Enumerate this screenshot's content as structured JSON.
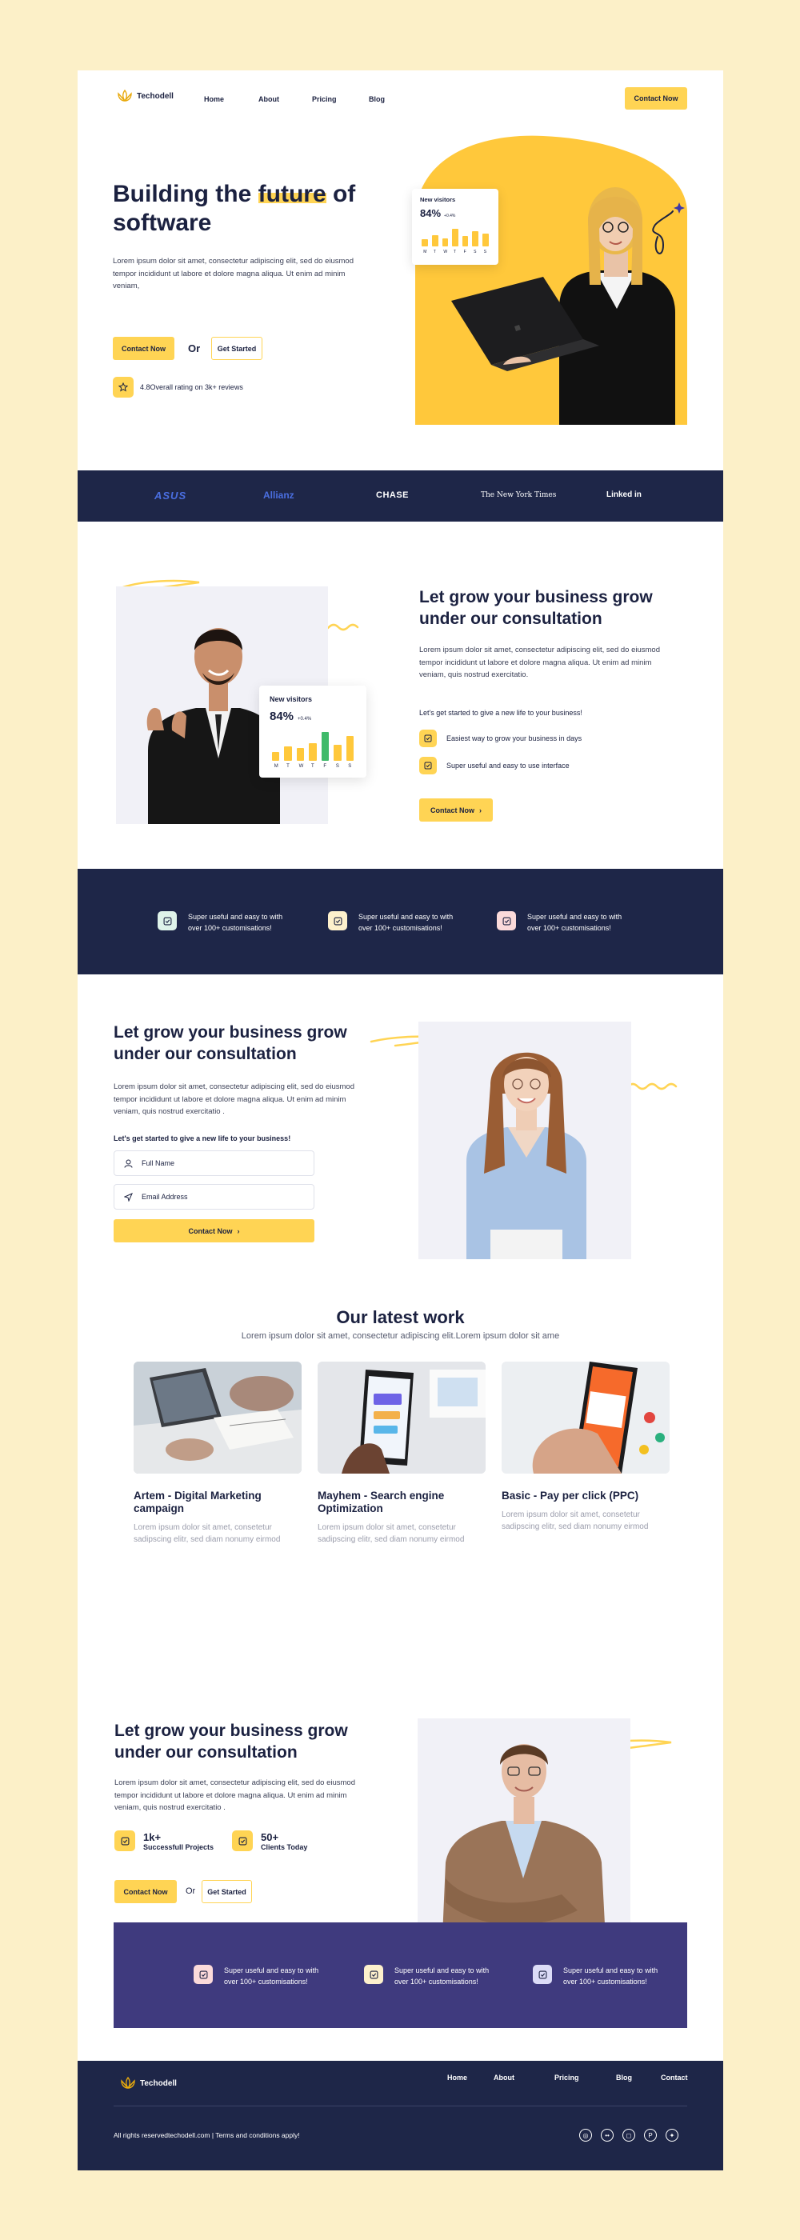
{
  "brand": {
    "name": "Techodell"
  },
  "nav": {
    "items": [
      "Home",
      "About",
      "Pricing",
      "Blog"
    ],
    "contact": "Contact Now"
  },
  "hero": {
    "title_pre": "Building the ",
    "title_hl": "future",
    "title_post": " of",
    "title_line2": "software",
    "desc": "Lorem ipsum dolor sit amet, consectetur adipiscing elit, sed do eiusmod tempor incididunt ut labore et dolore magna aliqua. Ut enim ad minim veniam,",
    "btn_contact": "Contact Now",
    "or": "Or",
    "btn_start": "Get Started",
    "rating": "4.8Overall rating on 3k+ reviews",
    "visitors": {
      "label": "New visitors",
      "value": "84%",
      "delta": "+0.4%",
      "days": [
        "M",
        "T",
        "W",
        "T",
        "F",
        "S",
        "S"
      ],
      "bars": [
        0.35,
        0.55,
        0.4,
        0.85,
        0.5,
        0.75,
        0.6
      ]
    }
  },
  "logos": [
    "ASUS",
    "Allianz",
    "CHASE",
    "The New York Times",
    "Linked in"
  ],
  "consult1": {
    "title": "Let grow your business grow under our consultation",
    "desc": "Lorem ipsum dolor sit amet, consectetur adipiscing elit, sed do eiusmod tempor incididunt ut labore et dolore magna aliqua. Ut enim ad minim veniam, quis nostrud exercitatio.",
    "sub": "Let's get started to give a new life to your business!",
    "points": [
      "Easiest way to grow your business in days",
      "Super useful and easy to use interface"
    ],
    "btn": "Contact Now",
    "visitors": {
      "label": "New visitors",
      "value": "84%",
      "delta": "+0.4%",
      "days": [
        "M",
        "T",
        "W",
        "T",
        "F",
        "S",
        "S"
      ],
      "bars": [
        0.3,
        0.5,
        0.45,
        0.6,
        1.0,
        0.55,
        0.85
      ]
    }
  },
  "features1": [
    {
      "text": "Super useful and easy to with over 100+ customisations!",
      "icon": "check-icon",
      "color": "#dff3ea"
    },
    {
      "text": "Super useful and easy to with over 100+ customisations!",
      "icon": "clock-icon",
      "color": "#fdf0cc"
    },
    {
      "text": "Super useful and easy to with over 100+ customisations!",
      "icon": "upload-icon",
      "color": "#fbdada"
    }
  ],
  "consult2": {
    "title": "Let grow your business grow under our consultation",
    "desc": "Lorem ipsum dolor sit amet, consectetur adipiscing elit, sed do eiusmod tempor incididunt ut labore et dolore magna aliqua. Ut enim ad minim veniam, quis nostrud exercitatio .",
    "sub": "Let's get started to give a new life to your business!",
    "name_placeholder": "Full Name",
    "email_placeholder": "Email Address",
    "btn": "Contact Now"
  },
  "work": {
    "title": "Our latest work",
    "subtitle": "Lorem ipsum dolor sit amet, consectetur adipiscing elit.Lorem ipsum dolor sit ame",
    "cards": [
      {
        "title": "Artem - Digital Marketing campaign",
        "desc": "Lorem ipsum dolor sit amet, consetetur sadipscing elitr, sed diam nonumy eirmod"
      },
      {
        "title": "Mayhem - Search engine Optimization",
        "desc": "Lorem ipsum dolor sit amet, consetetur sadipscing elitr, sed diam nonumy eirmod"
      },
      {
        "title": "Basic - Pay per click (PPC)",
        "desc": "Lorem ipsum dolor sit amet, consetetur sadipscing elitr, sed diam nonumy eirmod"
      }
    ]
  },
  "consult3": {
    "title": "Let grow your business grow under our consultation",
    "desc": "Lorem ipsum dolor sit amet, consectetur adipiscing elit, sed do eiusmod tempor incididunt ut labore et dolore magna aliqua. Ut enim ad minim veniam, quis nostrud exercitatio .",
    "stats": [
      {
        "value": "1k+",
        "label": "Successfull Projects"
      },
      {
        "value": "50+",
        "label": "Clients Today"
      }
    ],
    "btn_contact": "Contact Now",
    "or": "Or",
    "btn_start": "Get Started"
  },
  "features2": [
    {
      "text": "Super useful and easy to with over 100+ customisations!",
      "icon": "check-icon",
      "color": "#fbdada"
    },
    {
      "text": "Super useful and easy to with over 100+ customisations!",
      "icon": "check-icon",
      "color": "#fdf0cc"
    },
    {
      "text": "Super useful and easy to with over 100+ customisations!",
      "icon": "check-icon",
      "color": "#dcdcf7"
    }
  ],
  "footer": {
    "links": [
      "Home",
      "About",
      "Pricing",
      "Blog",
      "Contact"
    ],
    "copyright": "All rights reservedtechodell.com | Terms and conditions apply!",
    "social": [
      "dribbble-icon",
      "flickr-icon",
      "instagram-icon",
      "pinterest-icon",
      "twitter-icon"
    ]
  },
  "colors": {
    "accent": "#ffd454",
    "navy": "#1e2648",
    "purple": "#3f3a7e"
  }
}
